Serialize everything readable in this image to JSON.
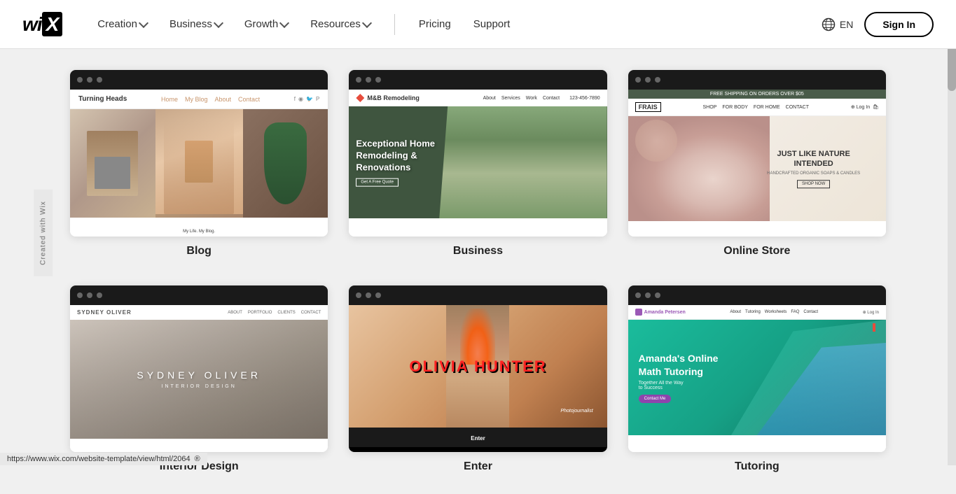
{
  "navbar": {
    "logo": "Wix",
    "nav_items": [
      {
        "label": "Creation",
        "has_dropdown": true
      },
      {
        "label": "Business",
        "has_dropdown": true
      },
      {
        "label": "Growth",
        "has_dropdown": true
      },
      {
        "label": "Resources",
        "has_dropdown": true
      }
    ],
    "plain_links": [
      {
        "label": "Pricing"
      },
      {
        "label": "Support"
      }
    ],
    "lang": "EN",
    "sign_in": "Sign In"
  },
  "templates": [
    {
      "id": "blog",
      "label": "Blog",
      "preview_type": "blog",
      "site_name": "Turning Heads",
      "nav_links": [
        "Home",
        "My Blog",
        "About",
        "Contact"
      ],
      "caption": "My Life. My Blog."
    },
    {
      "id": "business",
      "label": "Business",
      "preview_type": "business",
      "site_name": "M&B Remodeling",
      "nav_links": [
        "About",
        "Services",
        "Work",
        "Contact"
      ],
      "phone": "123-456-7890",
      "hero_text": "Exceptional Home Remodeling & Renovations"
    },
    {
      "id": "store",
      "label": "Online Store",
      "preview_type": "store",
      "banner": "FREE SHIPPING ON ORDERS OVER $05",
      "logo": "FRAIS",
      "nav_links": [
        "SHOP",
        "FOR BODY",
        "FOR HOME",
        "CONTACT"
      ],
      "hero_title": "JUST LIKE NATURE INTENDED",
      "hero_sub": "HANDCRAFTED ORGANIC SOAPS & CANDLES",
      "cta": "SHOP NOW"
    },
    {
      "id": "interior",
      "label": "Interior Design",
      "preview_type": "interior",
      "site_name": "SYDNEY OLIVER",
      "nav_links": [
        "ABOUT",
        "PORTFOLIO",
        "CLIENTS",
        "CONTACT"
      ],
      "subtitle": "INTERIOR DESIGN"
    },
    {
      "id": "photo",
      "label": "Enter",
      "preview_type": "photo",
      "name": "OLIVIA HUNTER",
      "subtitle": "Photojournalist",
      "enter": "Enter"
    },
    {
      "id": "tutor",
      "label": "Tutoring",
      "preview_type": "tutor",
      "logo_name": "Amanda Petersen",
      "nav_links": [
        "About",
        "Tutoring",
        "Worksheets",
        "FAQ",
        "Contact"
      ],
      "title": "Amanda's Online Math Tutoring",
      "subtitle": "Together All the Way to Success",
      "cta": "Contact Me"
    }
  ],
  "status_bar": {
    "url": "https://www.wix.com/website-template/view/html/2064",
    "copyright": "®"
  },
  "side_label": "Created with Wix"
}
